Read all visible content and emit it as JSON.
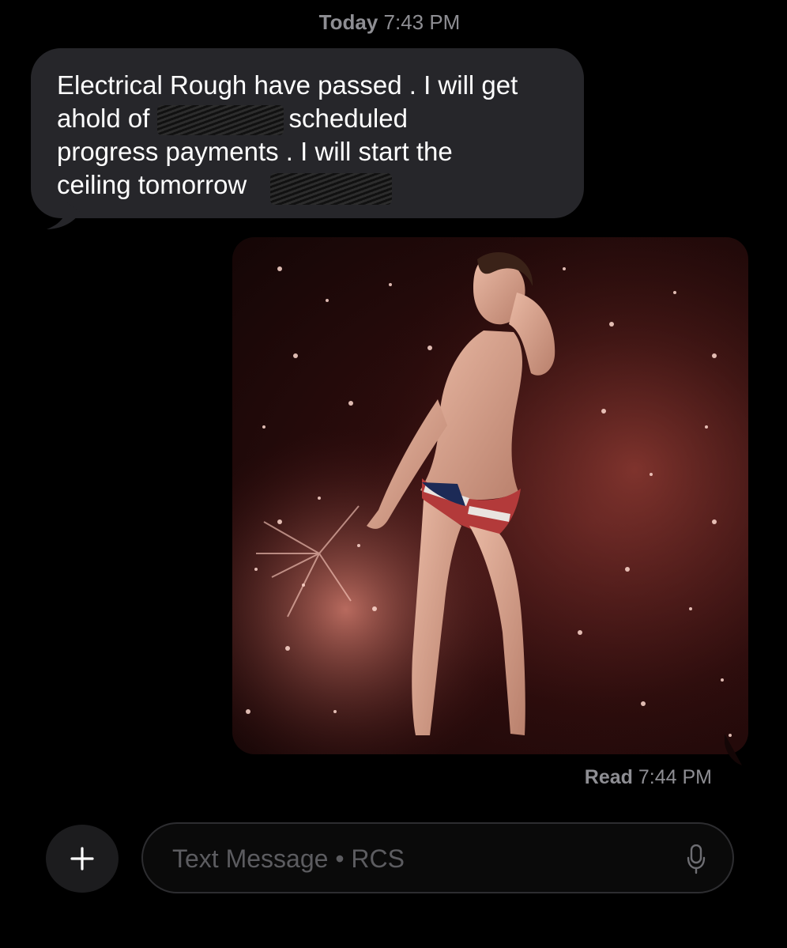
{
  "header": {
    "day": "Today",
    "time": "7:43 PM"
  },
  "incoming_message": {
    "text": "Electrical Rough have passed . I will get\nahold of        for the scheduled\nprogress payments . I will start the\nceiling tomorrow"
  },
  "outgoing_media": {
    "icon": "image-gif"
  },
  "read_receipt": {
    "label": "Read",
    "time": "7:44 PM"
  },
  "composer": {
    "placeholder": "Text Message • RCS",
    "add_icon": "plus-icon",
    "mic_icon": "microphone-icon"
  },
  "colors": {
    "background": "#000000",
    "incoming_bubble": "#26262a",
    "timestamp_text": "#8e8e93",
    "placeholder_text": "#5c5c60"
  }
}
